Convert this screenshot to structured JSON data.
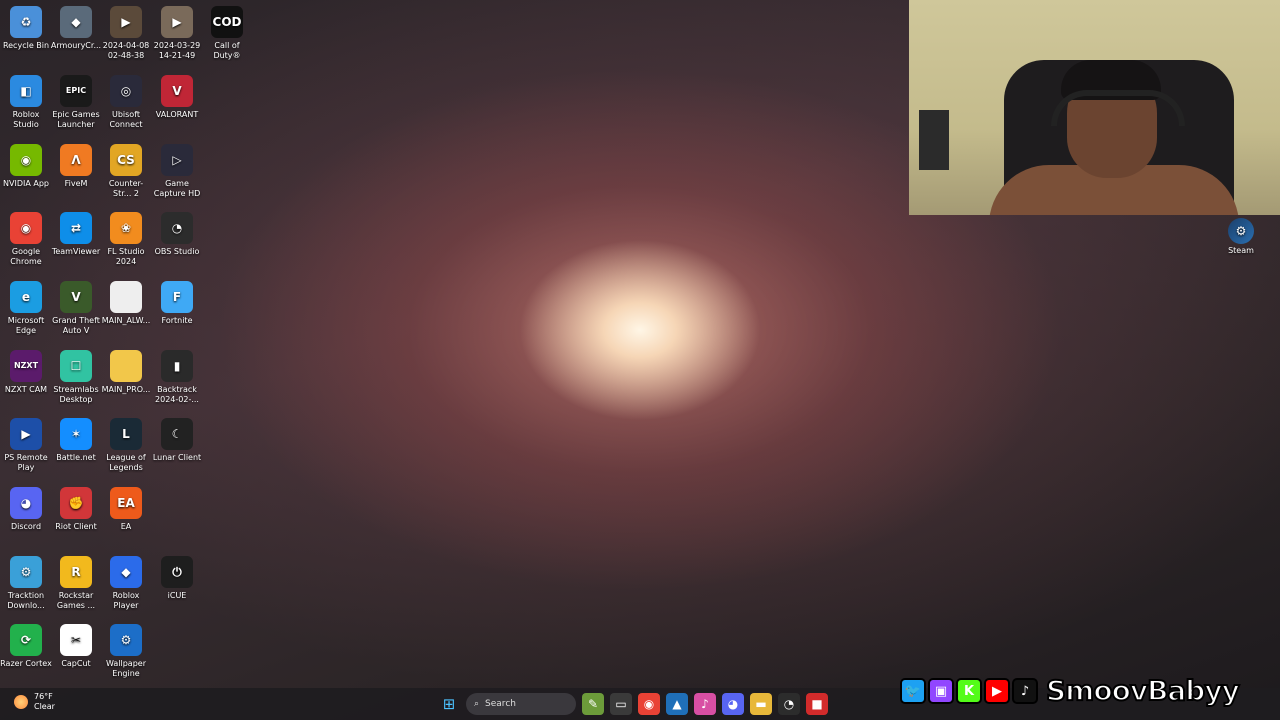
{
  "desktop_icons": [
    {
      "label": "Recycle Bin",
      "icon": "recycle-bin-icon",
      "color": "#4a90d9",
      "glyph": "♻"
    },
    {
      "label": "ArmouryCr...",
      "icon": "armoury-crate-icon",
      "color": "#5a6a7a",
      "glyph": "◆"
    },
    {
      "label": "2024-04-08 02-48-38",
      "icon": "video-file-icon",
      "color": "#5b4a3a",
      "glyph": "▶"
    },
    {
      "label": "2024-03-29 14-21-49",
      "icon": "video-file-icon",
      "color": "#7a6a5a",
      "glyph": "▶"
    },
    {
      "label": "Call of Duty®",
      "icon": "call-of-duty-icon",
      "color": "#111111",
      "glyph": "COD"
    },
    {
      "label": "Roblox Studio",
      "icon": "roblox-studio-icon",
      "color": "#2b8ae0",
      "glyph": "◧"
    },
    {
      "label": "Epic Games Launcher",
      "icon": "epic-games-icon",
      "color": "#1a1a1a",
      "glyph": "EPIC"
    },
    {
      "label": "Ubisoft Connect",
      "icon": "ubisoft-icon",
      "color": "#2a2a3a",
      "glyph": "◎"
    },
    {
      "label": "VALORANT",
      "icon": "valorant-icon",
      "color": "#c02636",
      "glyph": "V"
    },
    {
      "label": "NVIDIA App",
      "icon": "nvidia-icon",
      "color": "#76b900",
      "glyph": "◉"
    },
    {
      "label": "FiveM",
      "icon": "fivem-icon",
      "color": "#f07a22",
      "glyph": "Λ"
    },
    {
      "label": "Counter-Str... 2",
      "icon": "counter-strike-icon",
      "color": "#e2a624",
      "glyph": "CS"
    },
    {
      "label": "Game Capture HD",
      "icon": "game-capture-icon",
      "color": "#2a2a3a",
      "glyph": "▷"
    },
    {
      "label": "Google Chrome",
      "icon": "chrome-icon",
      "color": "#e94235",
      "glyph": "◉"
    },
    {
      "label": "TeamViewer",
      "icon": "teamviewer-icon",
      "color": "#0e8ee9",
      "glyph": "⇄"
    },
    {
      "label": "FL Studio 2024",
      "icon": "fl-studio-icon",
      "color": "#f28c1e",
      "glyph": "❀"
    },
    {
      "label": "OBS Studio",
      "icon": "obs-icon",
      "color": "#2c2c2c",
      "glyph": "◔"
    },
    {
      "label": "Microsoft Edge",
      "icon": "edge-icon",
      "color": "#1b9de2",
      "glyph": "e"
    },
    {
      "label": "Grand Theft Auto V",
      "icon": "gta-icon",
      "color": "#3a5a2a",
      "glyph": "V"
    },
    {
      "label": "MAIN_ALW...",
      "icon": "file-icon",
      "color": "#eeeeee",
      "glyph": ""
    },
    {
      "label": "Fortnite",
      "icon": "fortnite-icon",
      "color": "#3fa9f5",
      "glyph": "F"
    },
    {
      "label": "NZXT CAM",
      "icon": "nzxt-icon",
      "color": "#5b1b6b",
      "glyph": "NZXT"
    },
    {
      "label": "Streamlabs Desktop",
      "icon": "streamlabs-icon",
      "color": "#31c3a2",
      "glyph": "☐"
    },
    {
      "label": "MAIN_PRO...",
      "icon": "folder-icon",
      "color": "#f2c74a",
      "glyph": ""
    },
    {
      "label": "Backtrack 2024-02-...",
      "icon": "backtrack-icon",
      "color": "#2a2a2a",
      "glyph": "▮"
    },
    {
      "label": "PS Remote Play",
      "icon": "ps-remote-icon",
      "color": "#1d4fa8",
      "glyph": "▶"
    },
    {
      "label": "Battle.net",
      "icon": "battlenet-icon",
      "color": "#148eff",
      "glyph": "✶"
    },
    {
      "label": "League of Legends",
      "icon": "league-icon",
      "color": "#1a2a36",
      "glyph": "L"
    },
    {
      "label": "Lunar Client",
      "icon": "lunar-client-icon",
      "color": "#222222",
      "glyph": "☾"
    },
    {
      "label": "Discord",
      "icon": "discord-icon",
      "color": "#5865f2",
      "glyph": "◕"
    },
    {
      "label": "Riot Client",
      "icon": "riot-client-icon",
      "color": "#d13639",
      "glyph": "✊"
    },
    {
      "label": "EA",
      "icon": "ea-icon",
      "color": "#ee5a1b",
      "glyph": "EA"
    },
    {
      "label": "",
      "icon": "empty-slot",
      "color": "transparent",
      "glyph": ""
    },
    {
      "label": "Tracktion Downlo...",
      "icon": "tracktion-icon",
      "color": "#3aa0d8",
      "glyph": "⚙"
    },
    {
      "label": "Rockstar Games ...",
      "icon": "rockstar-icon",
      "color": "#f2b91d",
      "glyph": "R"
    },
    {
      "label": "Roblox Player",
      "icon": "roblox-player-icon",
      "color": "#2b6bea",
      "glyph": "◆"
    },
    {
      "label": "iCUE",
      "icon": "icue-icon",
      "color": "#1e1e1e",
      "glyph": "⏻"
    },
    {
      "label": "Razer Cortex",
      "icon": "razer-cortex-icon",
      "color": "#22b14c",
      "glyph": "⟳"
    },
    {
      "label": "CapCut",
      "icon": "capcut-icon",
      "color": "#ffffff",
      "glyph": "✂"
    },
    {
      "label": "Wallpaper Engine",
      "icon": "wallpaper-engine-icon",
      "color": "#1c6ec8",
      "glyph": "⚙"
    }
  ],
  "steam_icon": {
    "label": "Steam",
    "glyph": "⚙"
  },
  "weather": {
    "temp": "76°F",
    "condition": "Clear"
  },
  "taskbar": {
    "search_label": "Search",
    "apps": [
      {
        "icon": "folder-doodle-icon",
        "glyph": "✎",
        "color": "#6c9b3a"
      },
      {
        "icon": "task-view-icon",
        "glyph": "▭",
        "color": "#3a3a3a"
      },
      {
        "icon": "chrome-taskbar-icon",
        "glyph": "◉",
        "color": "#e94235"
      },
      {
        "icon": "photos-icon",
        "glyph": "▲",
        "color": "#1f6fb8"
      },
      {
        "icon": "itunes-icon",
        "glyph": "♪",
        "color": "#d84fa4"
      },
      {
        "icon": "discord-taskbar-icon",
        "glyph": "◕",
        "color": "#5865f2"
      },
      {
        "icon": "file-explorer-icon",
        "glyph": "▬",
        "color": "#e8b83a"
      },
      {
        "icon": "obs-taskbar-icon",
        "glyph": "◔",
        "color": "#2c2c2c"
      },
      {
        "icon": "red-app-icon",
        "glyph": "■",
        "color": "#d22b2b"
      }
    ]
  },
  "overlay": {
    "handle": "SmoovBabyy",
    "socials": [
      {
        "icon": "twitter-icon",
        "glyph": "🐦",
        "color": "#1da1f2"
      },
      {
        "icon": "twitch-icon",
        "glyph": "▣",
        "color": "#9146ff"
      },
      {
        "icon": "kick-icon",
        "glyph": "K",
        "color": "#53fc18"
      },
      {
        "icon": "youtube-icon",
        "glyph": "▶",
        "color": "#ff0000"
      },
      {
        "icon": "tiktok-icon",
        "glyph": "♪",
        "color": "#111111"
      }
    ]
  }
}
